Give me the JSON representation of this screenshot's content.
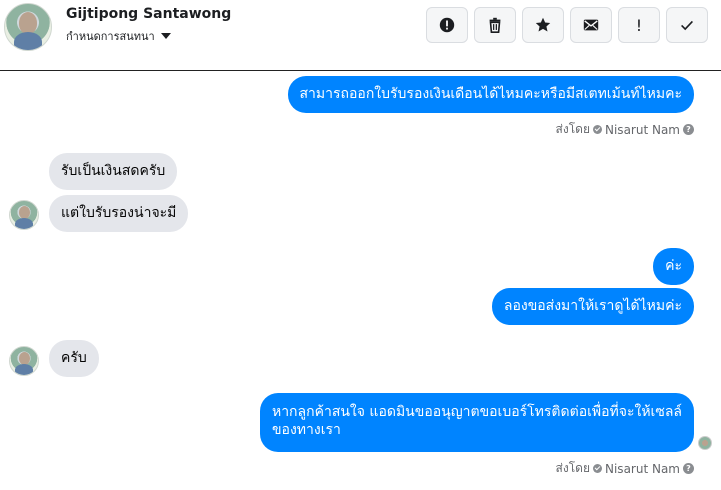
{
  "header": {
    "name": "Gijtipong Santawong",
    "subtitle": "กำหนดการสนทนา",
    "actions": [
      {
        "icon": "alert-circle-icon",
        "label": "!"
      },
      {
        "icon": "trash-icon",
        "label": ""
      },
      {
        "icon": "star-icon",
        "label": ""
      },
      {
        "icon": "envelope-icon",
        "label": ""
      },
      {
        "icon": "exclamation-icon",
        "label": "!"
      },
      {
        "icon": "check-icon",
        "label": ""
      }
    ]
  },
  "messages": [
    {
      "side": "out",
      "text": "สามารถออกใบรับรองเงินเดือนได้ไหมคะหรือมีสเตทเม้นท์ไหมคะ"
    },
    {
      "side": "in",
      "text": "รับเป็นเงินสดครับ"
    },
    {
      "side": "in",
      "text": "แต่ใบรับรองน่าจะมี"
    },
    {
      "side": "out",
      "text": "ค่ะ"
    },
    {
      "side": "out",
      "text": "ลองขอส่งมาให้เราดูได้ไหมค่ะ"
    },
    {
      "side": "in",
      "text": "ครับ"
    },
    {
      "side": "out",
      "text_line1": "หากลูกค้าสนใจ แอดมินขออนุญาตขอเบอร์โทรติดต่อเพื่อที่จะให้เซลล์",
      "text_line2": "ของทางเรา"
    }
  ],
  "sent_by": {
    "prefix": "ส่งโดย",
    "author": "Nisarut Nam",
    "help": "?"
  },
  "colors": {
    "outgoing": "#0084ff",
    "incoming": "#e4e6eb",
    "meta_text": "#65676b"
  }
}
